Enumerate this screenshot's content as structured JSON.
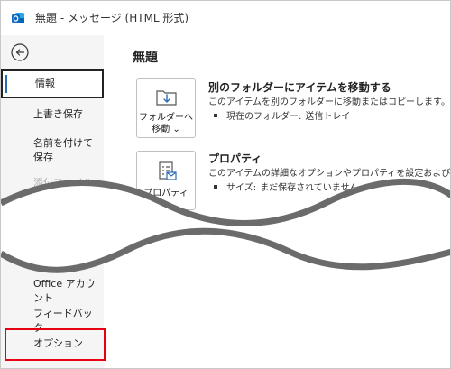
{
  "window": {
    "title": "無題 - メッセージ (HTML 形式)"
  },
  "colors": {
    "app_icon": "#0f6cbd",
    "accent": "#2b6cb8",
    "highlight": "#e60012",
    "sidebar_bg": "#f5f5f5"
  },
  "sidebar": {
    "back_icon": "back-arrow-icon",
    "items": [
      {
        "label": "情報",
        "selected": true
      },
      {
        "label": "上書き保存"
      },
      {
        "label": "名前を付けて保存"
      },
      {
        "label": "添付ファイルの保存",
        "disabled": true
      },
      {
        "label": "Office アカウント"
      },
      {
        "label": "フィードバック"
      },
      {
        "label": "オプション",
        "highlighted": true
      }
    ]
  },
  "main": {
    "page_title": "無題",
    "move": {
      "button_label_line1": "フォルダーへ",
      "button_label_line2": "移動 ⌄",
      "icon": "folder-move-icon",
      "title": "別のフォルダーにアイテムを移動する",
      "description": "このアイテムを別のフォルダーに移動またはコピーします。",
      "detail_label": "現在のフォルダー:",
      "detail_value": "送信トレイ"
    },
    "properties": {
      "button_label": "プロパティ",
      "icon": "properties-icon",
      "title": "プロパティ",
      "description": "このアイテムの詳細なオプションやプロパティを設定および確認します。",
      "detail_label": "サイズ:",
      "detail_value": "まだ保存されていません"
    }
  }
}
